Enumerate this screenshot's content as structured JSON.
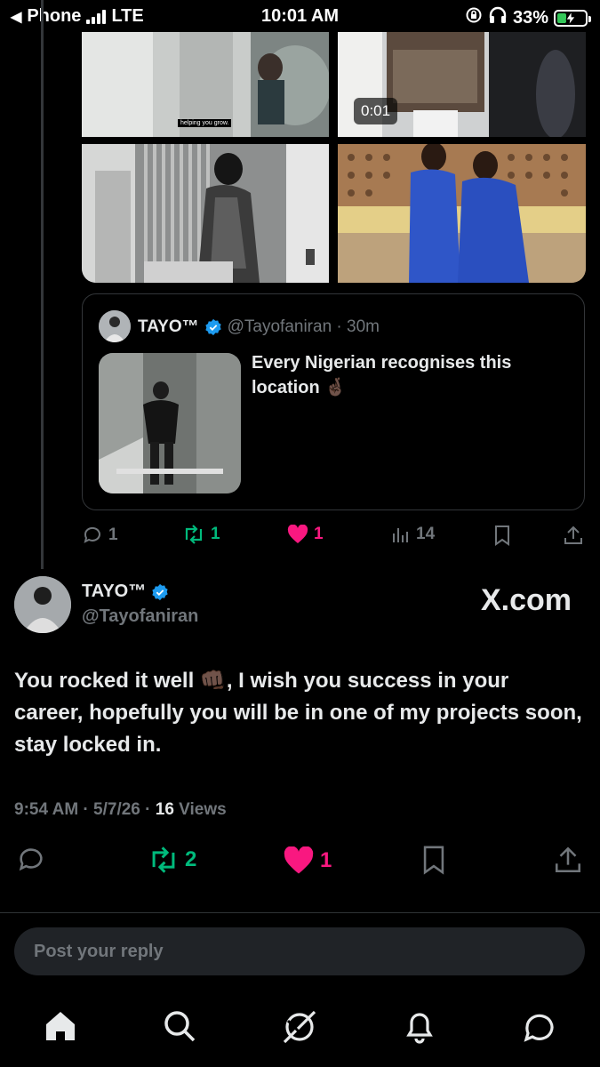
{
  "status_bar": {
    "carrier": "Phone",
    "network": "LTE",
    "time": "10:01 AM",
    "battery": "33%",
    "battery_level": 0.33
  },
  "parent_post": {
    "video_duration": "0:01",
    "media_caption": "helping you grow.",
    "quote": {
      "name": "TAYO™",
      "handle": "@Tayofaniran · 30m",
      "text": "Every Nigerian recognises this location 🤞🏿"
    },
    "actions": {
      "replies": "1",
      "reposts": "1",
      "likes": "1",
      "views": "14"
    }
  },
  "main_post": {
    "name": "TAYO™",
    "handle": "@Tayofaniran",
    "watermark": "X.com",
    "text": "You rocked it well 👊🏿, I wish you success in your career, hopefully you will be in one of my projects soon, stay locked in.",
    "timestamp": "9:54 AM · 5/7/26 · ",
    "views_count": "16",
    "views_label": " Views",
    "actions": {
      "reposts": "2",
      "likes": "1"
    }
  },
  "reply": {
    "placeholder": "Post your reply"
  },
  "colors": {
    "accent_blue": "#1d9bf0",
    "repost_green": "#00ba7c",
    "like_pink": "#f91880",
    "muted": "#71767b"
  },
  "nav": [
    "home-icon",
    "search-icon",
    "grok-icon",
    "notifications-icon",
    "messages-icon"
  ]
}
